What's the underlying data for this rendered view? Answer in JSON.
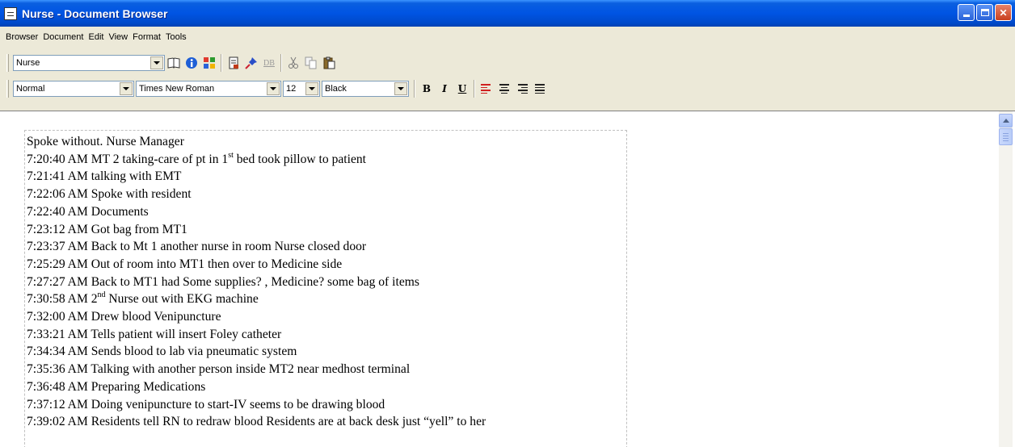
{
  "window": {
    "title": "Nurse - Document Browser"
  },
  "menu": [
    "Browser",
    "Document",
    "Edit",
    "View",
    "Format",
    "Tools"
  ],
  "toolbar": {
    "document_select": "Nurse",
    "db_label": "DB"
  },
  "format": {
    "style": "Normal",
    "font": "Times New Roman",
    "size": "12",
    "color": "Black",
    "bold": "B",
    "italic": "I",
    "underline": "U"
  },
  "document": {
    "lines": [
      {
        "pre": "Spoke without. Nurse Manager",
        "sup": "",
        "post": ""
      },
      {
        "pre": "7:20:40 AM MT 2 taking-care of pt in 1",
        "sup": "st",
        "post": " bed took pillow to patient"
      },
      {
        "pre": "7:21:41 AM talking with EMT",
        "sup": "",
        "post": ""
      },
      {
        "pre": "7:22:06 AM Spoke with resident",
        "sup": "",
        "post": ""
      },
      {
        "pre": "7:22:40 AM Documents",
        "sup": "",
        "post": ""
      },
      {
        "pre": "7:23:12 AM Got bag from MT1",
        "sup": "",
        "post": ""
      },
      {
        "pre": "7:23:37 AM Back to Mt 1 another nurse in room Nurse closed door",
        "sup": "",
        "post": ""
      },
      {
        "pre": "7:25:29 AM Out of room into MT1 then over to Medicine side",
        "sup": "",
        "post": ""
      },
      {
        "pre": "7:27:27 AM Back to MT1 had Some supplies? , Medicine? some bag of items",
        "sup": "",
        "post": ""
      },
      {
        "pre": "7:30:58 AM 2",
        "sup": "nd",
        "post": " Nurse out with EKG machine"
      },
      {
        "pre": "7:32:00 AM Drew blood Venipuncture",
        "sup": "",
        "post": ""
      },
      {
        "pre": "7:33:21 AM Tells patient will insert Foley catheter",
        "sup": "",
        "post": ""
      },
      {
        "pre": "7:34:34 AM Sends blood to lab via pneumatic system",
        "sup": "",
        "post": ""
      },
      {
        "pre": "7:35:36 AM Talking with another person inside MT2 near medhost terminal",
        "sup": "",
        "post": ""
      },
      {
        "pre": "7:36:48 AM Preparing Medications",
        "sup": "",
        "post": ""
      },
      {
        "pre": "7:37:12 AM Doing venipuncture to start-IV seems to be drawing blood",
        "sup": "",
        "post": ""
      },
      {
        "pre": "7:39:02 AM Residents tell RN to redraw blood Residents are at back desk just “yell” to her",
        "sup": "",
        "post": ""
      }
    ]
  }
}
